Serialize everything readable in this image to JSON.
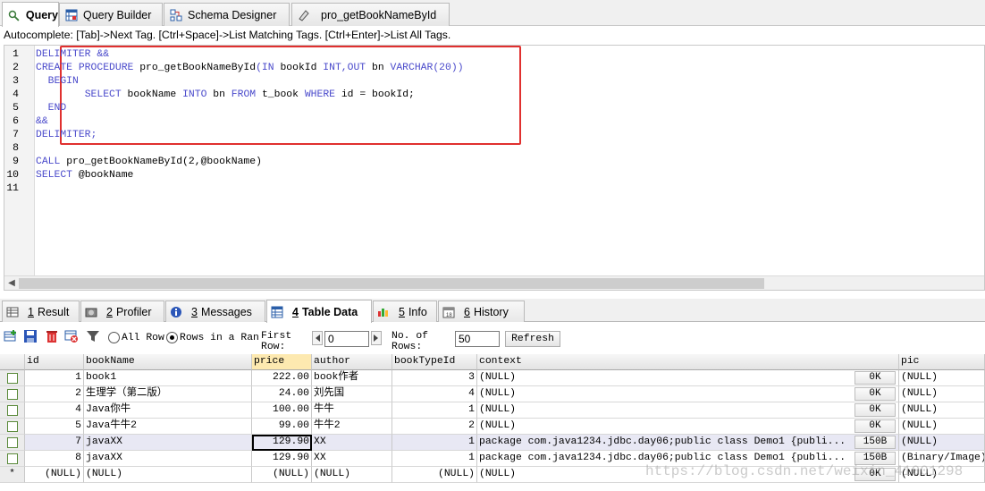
{
  "top_tabs": [
    {
      "label": "Query",
      "active": true
    },
    {
      "label": "Query Builder"
    },
    {
      "label": "Schema Designer"
    },
    {
      "label": "pro_getBookNameById"
    }
  ],
  "hint": "Autocomplete: [Tab]->Next Tag. [Ctrl+Space]->List Matching Tags. [Ctrl+Enter]->List All Tags.",
  "editor": {
    "line_numbers": [
      "1",
      "2",
      "3",
      "4",
      "5",
      "6",
      "7",
      "8",
      "9",
      "10",
      "11"
    ],
    "lines": [
      [
        [
          "kw",
          "DELIMITER &&"
        ]
      ],
      [
        [
          "kw",
          "CREATE PROCEDURE "
        ],
        [
          "tx",
          "pro_getBookNameById"
        ],
        [
          "kw",
          "(IN "
        ],
        [
          "tx",
          "bookId "
        ],
        [
          "kw",
          "INT,OUT "
        ],
        [
          "tx",
          "bn "
        ],
        [
          "kw",
          "VARCHAR(20))"
        ]
      ],
      [
        [
          "kw",
          "  BEGIN"
        ]
      ],
      [
        [
          "tx",
          "        "
        ],
        [
          "kw",
          "SELECT "
        ],
        [
          "tx",
          "bookName "
        ],
        [
          "kw",
          "INTO "
        ],
        [
          "tx",
          "bn "
        ],
        [
          "kw",
          "FROM "
        ],
        [
          "tx",
          "t_book "
        ],
        [
          "kw",
          "WHERE "
        ],
        [
          "tx",
          "id = bookId;"
        ]
      ],
      [
        [
          "kw",
          "  END"
        ]
      ],
      [
        [
          "kw",
          "&&"
        ]
      ],
      [
        [
          "kw",
          "DELIMITER;"
        ]
      ],
      [],
      [
        [
          "kw",
          "CALL "
        ],
        [
          "tx",
          "pro_getBookNameById(2,@bookName)"
        ]
      ],
      [
        [
          "kw",
          "SELECT "
        ],
        [
          "tx",
          "@bookName"
        ]
      ],
      []
    ]
  },
  "result_tabs": [
    {
      "num": "1",
      "label": "Result"
    },
    {
      "num": "2",
      "label": "Profiler"
    },
    {
      "num": "3",
      "label": "Messages"
    },
    {
      "num": "4",
      "label": "Table Data",
      "active": true
    },
    {
      "num": "5",
      "label": "Info"
    },
    {
      "num": "6",
      "label": "History"
    }
  ],
  "toolbar": {
    "all_rows": "All Row:",
    "rows_in_range": "Rows in a Rang",
    "first_row_label_1": "First",
    "first_row_label_2": "Row:",
    "first_row_value": "0",
    "no_rows_label_1": "No. of",
    "no_rows_label_2": "Rows:",
    "no_rows_value": "50",
    "refresh": "Refresh"
  },
  "grid": {
    "columns": [
      "id",
      "bookName",
      "price",
      "author",
      "bookTypeId",
      "context",
      "",
      "pic"
    ],
    "rows": [
      [
        "1",
        "book1",
        "222.00",
        "book作者",
        "3",
        "(NULL)",
        "0K",
        "(NULL)"
      ],
      [
        "2",
        "生理学（第二版）",
        "24.00",
        "刘先国",
        "4",
        "(NULL)",
        "0K",
        "(NULL)"
      ],
      [
        "4",
        "Java你牛",
        "100.00",
        "牛牛",
        "1",
        "(NULL)",
        "0K",
        "(NULL)"
      ],
      [
        "5",
        "Java牛牛2",
        "99.00",
        "牛牛2",
        "2",
        "(NULL)",
        "0K",
        "(NULL)"
      ],
      [
        "7",
        "javaXX",
        "129.90",
        "XX",
        "1",
        "package com.java1234.jdbc.day06;public class Demo1 {publi...",
        "150B",
        "(NULL)"
      ],
      [
        "8",
        "javaXX",
        "129.90",
        "XX",
        "1",
        "package com.java1234.jdbc.day06;public class Demo1 {publi...",
        "150B",
        "(Binary/Image)"
      ],
      [
        "(NULL)",
        "(NULL)",
        "(NULL)",
        "(NULL)",
        "(NULL)",
        "(NULL)",
        "0K",
        "(NULL)"
      ]
    ],
    "new_row_marker": "*"
  },
  "watermark": "https://blog.csdn.net/weixin_41001298"
}
